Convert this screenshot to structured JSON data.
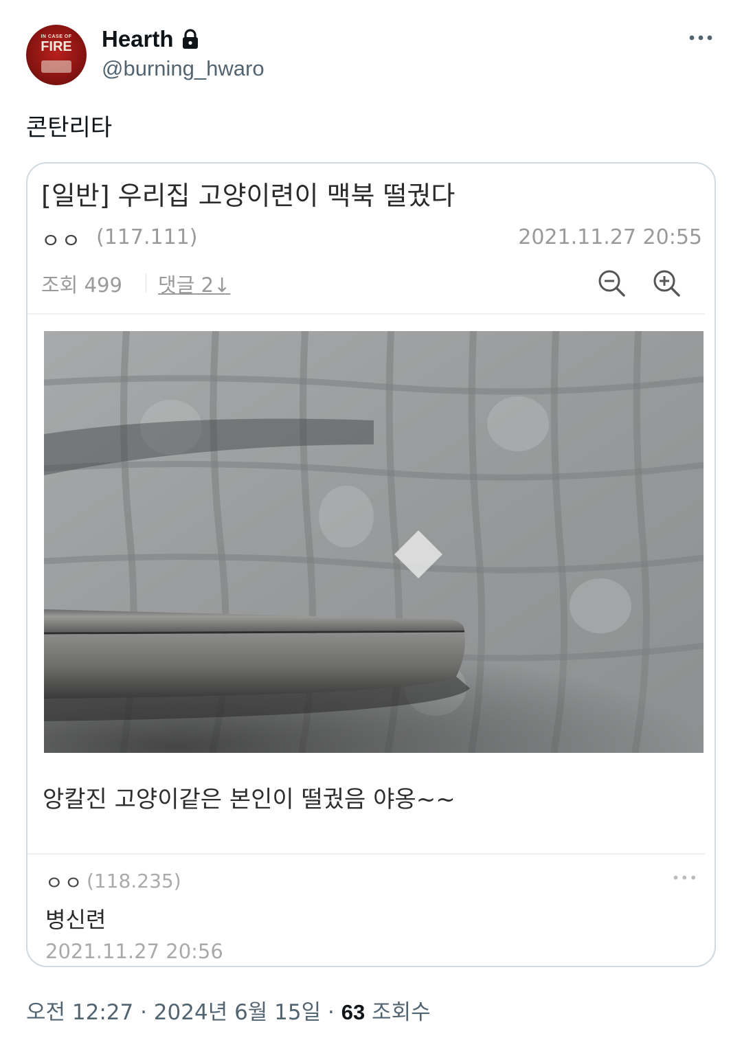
{
  "author": {
    "display_name": "Hearth",
    "handle": "@burning_hwaro",
    "avatar_sign_small": "IN CASE OF",
    "avatar_sign_big": "FIRE",
    "lock_icon": "lock-icon"
  },
  "tweet": {
    "text": "콘탄리타"
  },
  "embedded_post": {
    "title": "[일반] 우리집 고양이련이 맥북 떨궜다",
    "author": "ㅇㅇ",
    "author_ip": "(117.111)",
    "date": "2021.11.27 20:55",
    "views": "조회 499",
    "comments": "댓글 2↓",
    "caption": "앙칼진 고양이같은 본인이 떨궜음 야옹~~",
    "comment": {
      "author": "ㅇㅇ",
      "ip": "(118.235)",
      "text": "병신련",
      "date": "2021.11.27 20:56",
      "more": "•••"
    }
  },
  "footer": {
    "time": "오전 12:27",
    "date": "2024년 6월 15일",
    "sep": " · ",
    "views_count": "63",
    "views_label": "조회수"
  },
  "colors": {
    "text_primary": "#0f1419",
    "text_secondary": "#536471",
    "card_border": "#cfd9de"
  }
}
